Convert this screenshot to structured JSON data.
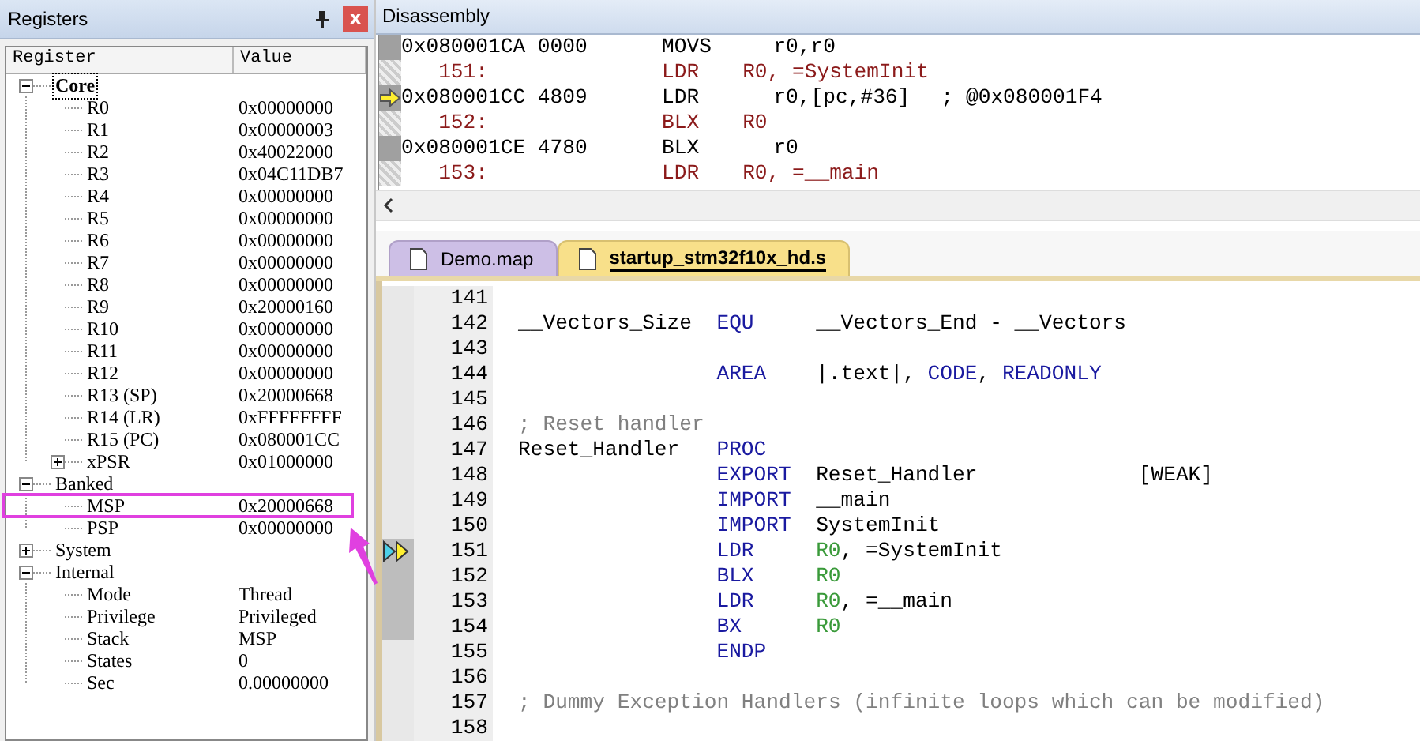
{
  "registers": {
    "title": "Registers",
    "close": "x",
    "columns": [
      "Register",
      "Value"
    ],
    "tree": [
      {
        "name": "Core",
        "selected": true,
        "highlighted": false,
        "expanded": true,
        "children": [
          {
            "name": "R0",
            "value": "0x00000000",
            "selected": false,
            "highlighted": false
          },
          {
            "name": "R1",
            "value": "0x00000003",
            "selected": false,
            "highlighted": false
          },
          {
            "name": "R2",
            "value": "0x40022000",
            "selected": false,
            "highlighted": false
          },
          {
            "name": "R3",
            "value": "0x04C11DB7",
            "selected": false,
            "highlighted": false
          },
          {
            "name": "R4",
            "value": "0x00000000",
            "selected": false,
            "highlighted": false
          },
          {
            "name": "R5",
            "value": "0x00000000",
            "selected": false,
            "highlighted": false
          },
          {
            "name": "R6",
            "value": "0x00000000",
            "selected": false,
            "highlighted": false
          },
          {
            "name": "R7",
            "value": "0x00000000",
            "selected": false,
            "highlighted": false
          },
          {
            "name": "R8",
            "value": "0x00000000",
            "selected": false,
            "highlighted": false
          },
          {
            "name": "R9",
            "value": "0x20000160",
            "selected": false,
            "highlighted": false
          },
          {
            "name": "R10",
            "value": "0x00000000",
            "selected": false,
            "highlighted": false
          },
          {
            "name": "R11",
            "value": "0x00000000",
            "selected": false,
            "highlighted": false
          },
          {
            "name": "R12",
            "value": "0x00000000",
            "selected": false,
            "highlighted": false
          },
          {
            "name": "R13 (SP)",
            "value": "0x20000668",
            "selected": false,
            "highlighted": false
          },
          {
            "name": "R14 (LR)",
            "value": "0xFFFFFFFF",
            "selected": false,
            "highlighted": false
          },
          {
            "name": "R15 (PC)",
            "value": "0x080001CC",
            "selected": false,
            "highlighted": false
          },
          {
            "name": "xPSR",
            "value": "0x01000000",
            "selected": false,
            "highlighted": false,
            "expanded": false
          }
        ]
      },
      {
        "name": "Banked",
        "selected": false,
        "highlighted": false,
        "expanded": true,
        "children": [
          {
            "name": "MSP",
            "value": "0x20000668",
            "selected": false,
            "highlighted": true
          },
          {
            "name": "PSP",
            "value": "0x00000000",
            "selected": false,
            "highlighted": false
          }
        ]
      },
      {
        "name": "System",
        "selected": false,
        "highlighted": false,
        "expanded": false
      },
      {
        "name": "Internal",
        "selected": false,
        "highlighted": false,
        "expanded": true,
        "children": [
          {
            "name": "Mode",
            "value": "Thread",
            "selected": false,
            "highlighted": false
          },
          {
            "name": "Privilege",
            "value": "Privileged",
            "selected": false,
            "highlighted": false
          },
          {
            "name": "Stack",
            "value": "MSP",
            "selected": false,
            "highlighted": false
          },
          {
            "name": "States",
            "value": "0",
            "selected": false,
            "highlighted": false
          },
          {
            "name": "Sec",
            "value": "0.00000000",
            "selected": false,
            "highlighted": false
          }
        ]
      }
    ]
  },
  "disassembly": {
    "title": "Disassembly",
    "lines": [
      {
        "kind": "asm",
        "address": "0x080001CA 0000",
        "mnemonic": "MOVS",
        "operands": "r0,r0",
        "current": false
      },
      {
        "kind": "src",
        "line_no": "151:",
        "mnemonic": "LDR",
        "operands": "R0, =SystemInit",
        "current": false
      },
      {
        "kind": "asm",
        "address": "0x080001CC 4809",
        "mnemonic": "LDR",
        "operands": "r0,[pc,#36]",
        "comment": "; @0x080001F4",
        "current": true
      },
      {
        "kind": "src",
        "line_no": "152:",
        "mnemonic": "BLX",
        "operands": "R0",
        "current": false
      },
      {
        "kind": "asm",
        "address": "0x080001CE 4780",
        "mnemonic": "BLX",
        "operands": "r0",
        "current": false
      },
      {
        "kind": "src",
        "line_no": "153:",
        "mnemonic": "LDR",
        "operands": "R0, =__main",
        "current": false
      }
    ]
  },
  "tabs": [
    {
      "label": "Demo.map",
      "selected": false
    },
    {
      "label": "startup_stm32f10x_hd.s",
      "selected": true
    }
  ],
  "editor": {
    "lines": [
      {
        "number": "141",
        "current": false,
        "covered": false
      },
      {
        "number": "142",
        "current": false,
        "covered": false,
        "label": "__Vectors_Size",
        "op": "EQU",
        "args": [
          {
            "kind": "plain",
            "text": "__Vectors_End - __Vectors"
          }
        ]
      },
      {
        "number": "143",
        "current": false,
        "covered": false
      },
      {
        "number": "144",
        "current": false,
        "covered": false,
        "op": "AREA",
        "args": [
          {
            "kind": "plain",
            "text": "|.text|, "
          },
          {
            "kind": "kw",
            "text": "CODE"
          },
          {
            "kind": "plain",
            "text": ", "
          },
          {
            "kind": "kw",
            "text": "READONLY"
          }
        ]
      },
      {
        "number": "145",
        "current": false,
        "covered": false
      },
      {
        "number": "146",
        "current": false,
        "covered": false,
        "comment": "; Reset handler"
      },
      {
        "number": "147",
        "current": false,
        "covered": false,
        "label": "Reset_Handler",
        "op": "PROC"
      },
      {
        "number": "148",
        "current": false,
        "covered": false,
        "op": "EXPORT",
        "args": [
          {
            "kind": "plain",
            "text": "Reset_Handler             [WEAK]"
          }
        ]
      },
      {
        "number": "149",
        "current": false,
        "covered": false,
        "op": "IMPORT",
        "args": [
          {
            "kind": "plain",
            "text": "__main"
          }
        ]
      },
      {
        "number": "150",
        "current": false,
        "covered": false,
        "op": "IMPORT",
        "args": [
          {
            "kind": "plain",
            "text": "SystemInit"
          }
        ]
      },
      {
        "number": "151",
        "current": true,
        "covered": true,
        "op": "LDR",
        "args": [
          {
            "kind": "reg",
            "text": "R0"
          },
          {
            "kind": "plain",
            "text": ", =SystemInit"
          }
        ]
      },
      {
        "number": "152",
        "current": false,
        "covered": true,
        "op": "BLX",
        "args": [
          {
            "kind": "reg",
            "text": "R0"
          }
        ]
      },
      {
        "number": "153",
        "current": false,
        "covered": true,
        "op": "LDR",
        "args": [
          {
            "kind": "reg",
            "text": "R0"
          },
          {
            "kind": "plain",
            "text": ", =__main"
          }
        ]
      },
      {
        "number": "154",
        "current": false,
        "covered": true,
        "op": "BX",
        "args": [
          {
            "kind": "reg",
            "text": "R0"
          }
        ]
      },
      {
        "number": "155",
        "current": false,
        "covered": false,
        "op": "ENDP"
      },
      {
        "number": "156",
        "current": false,
        "covered": false
      },
      {
        "number": "157",
        "current": false,
        "covered": false,
        "comment": "; Dummy Exception Handlers (infinite loops which can be modified)"
      },
      {
        "number": "158",
        "current": false,
        "covered": false
      }
    ]
  }
}
